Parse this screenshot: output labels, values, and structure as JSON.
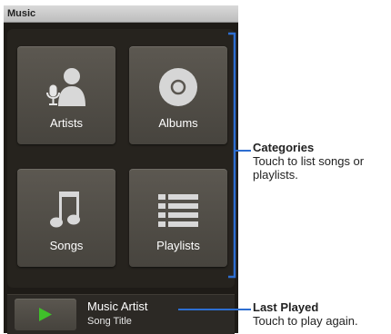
{
  "app": {
    "title": "Music"
  },
  "categories": [
    {
      "label": "Artists",
      "icon": "artists-icon"
    },
    {
      "label": "Albums",
      "icon": "albums-icon"
    },
    {
      "label": "Songs",
      "icon": "songs-icon"
    },
    {
      "label": "Playlists",
      "icon": "playlists-icon"
    }
  ],
  "last_played": {
    "artist": "Music Artist",
    "song": "Song Title",
    "icon": "play-icon"
  },
  "callouts": {
    "categories": {
      "title": "Categories",
      "text": "Touch to list songs or playlists."
    },
    "last_played": {
      "title": "Last Played",
      "text": "Touch to play again."
    }
  },
  "colors": {
    "accent": "#2d6ed1",
    "play": "#3fbf2a",
    "background": "#1e1b17"
  }
}
